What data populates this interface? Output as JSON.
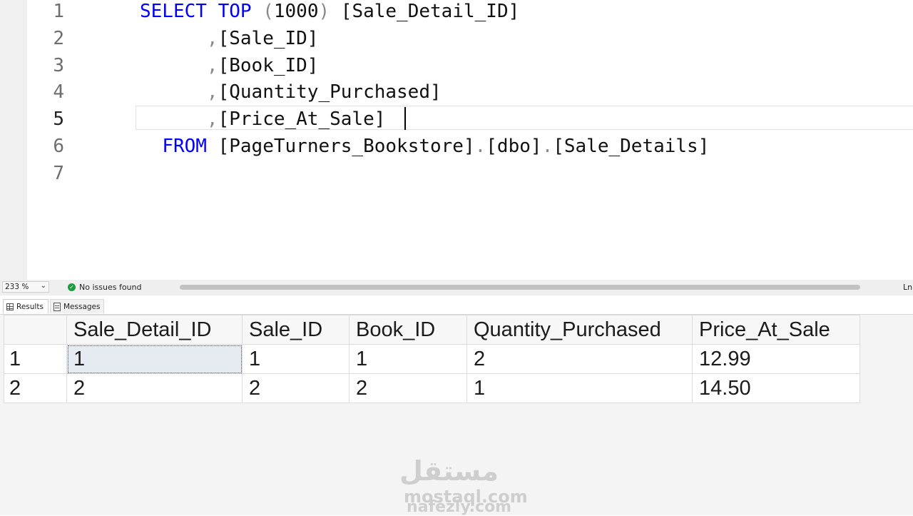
{
  "editor": {
    "line_numbers": [
      "1",
      "2",
      "3",
      "4",
      "5",
      "6",
      "7"
    ],
    "current_line": "5",
    "lines": [
      {
        "tokens": [
          {
            "t": "SELECT",
            "k": "kw"
          },
          {
            "t": " ",
            "k": ""
          },
          {
            "t": "TOP",
            "k": "kw"
          },
          {
            "t": " ",
            "k": ""
          },
          {
            "t": "(",
            "k": "gr"
          },
          {
            "t": "1000",
            "k": ""
          },
          {
            "t": ")",
            "k": "gr"
          },
          {
            "t": " [Sale_Detail_ID]",
            "k": ""
          }
        ]
      },
      {
        "tokens": [
          {
            "t": "      ",
            "k": ""
          },
          {
            "t": ",",
            "k": "gr"
          },
          {
            "t": "[Sale_ID]",
            "k": ""
          }
        ]
      },
      {
        "tokens": [
          {
            "t": "      ",
            "k": ""
          },
          {
            "t": ",",
            "k": "gr"
          },
          {
            "t": "[Book_ID]",
            "k": ""
          }
        ]
      },
      {
        "tokens": [
          {
            "t": "      ",
            "k": ""
          },
          {
            "t": ",",
            "k": "gr"
          },
          {
            "t": "[Quantity_Purchased]",
            "k": ""
          }
        ]
      },
      {
        "tokens": [
          {
            "t": "      ",
            "k": ""
          },
          {
            "t": ",",
            "k": "gr"
          },
          {
            "t": "[Price_At_Sale]",
            "k": ""
          }
        ]
      },
      {
        "tokens": [
          {
            "t": "  ",
            "k": ""
          },
          {
            "t": "FROM",
            "k": "kw"
          },
          {
            "t": " [PageTurners_Bookstore]",
            "k": ""
          },
          {
            "t": ".",
            "k": "gr"
          },
          {
            "t": "[dbo]",
            "k": ""
          },
          {
            "t": ".",
            "k": "gr"
          },
          {
            "t": "[Sale_Details]",
            "k": ""
          }
        ]
      },
      {
        "tokens": []
      }
    ]
  },
  "statusbar": {
    "zoom": "233 %",
    "issues": "No issues found",
    "line_label": "Ln:"
  },
  "tabs": {
    "results": "Results",
    "messages": "Messages"
  },
  "results": {
    "columns": [
      "Sale_Detail_ID",
      "Sale_ID",
      "Book_ID",
      "Quantity_Purchased",
      "Price_At_Sale"
    ],
    "rows": [
      {
        "num": "1",
        "cells": [
          "1",
          "1",
          "1",
          "2",
          "12.99"
        ]
      },
      {
        "num": "2",
        "cells": [
          "2",
          "2",
          "2",
          "1",
          "14.50"
        ]
      }
    ]
  },
  "watermark": {
    "arabic": "مستقل",
    "line1": "mostaql.com",
    "line2": "nafezly.com"
  }
}
